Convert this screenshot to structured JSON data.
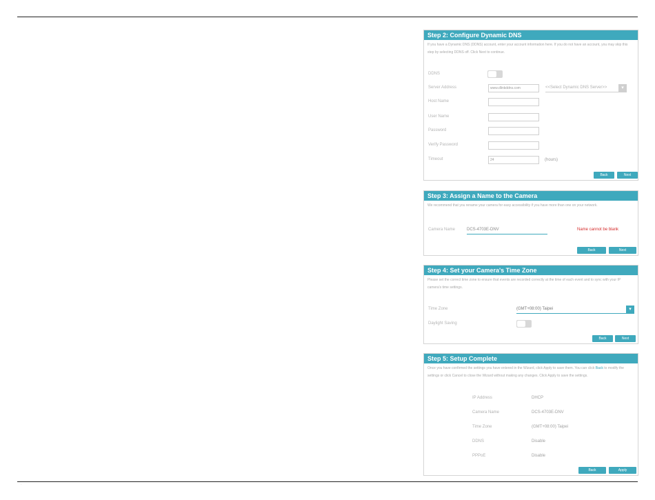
{
  "page": {
    "page_mark": "·"
  },
  "step2": {
    "title": "Step 2: Configure Dynamic DNS",
    "description": "If you have a Dynamic DNS (DDNS) account, enter your account information here. If you do not have an account, you may skip this step by selecting DDNS off. Click Next to continue.",
    "ddns_label": "DDNS",
    "server_address_label": "Server Address",
    "server_address_value": "www.dlinkddns.com",
    "server_select_value": "<<Select Dynamic DNS Server>>",
    "host_name_label": "Host Name",
    "user_name_label": "User Name",
    "password_label": "Password",
    "verify_password_label": "Verify Password",
    "timeout_label": "Timeout",
    "timeout_value": "24",
    "timeout_unit": "(hours)",
    "back_label": "Back",
    "next_label": "Next"
  },
  "step3": {
    "title": "Step 3: Assign a Name to the Camera",
    "description": "We recommend that you rename your camera for easy accessibility if you have more than one on your network.",
    "camera_name_label": "Camera Name",
    "camera_name_value": "DCS-4703E-DNV",
    "warning": "Name cannot be blank",
    "back_label": "Back",
    "next_label": "Next"
  },
  "step4": {
    "title": "Step 4: Set your Camera's Time Zone",
    "description": "Please set the correct time zone to ensure that events are recorded correctly at the time of each event and to sync with your IP camera's time settings.",
    "time_zone_label": "Time Zone",
    "time_zone_value": "(GMT+08:00) Taipei",
    "daylight_saving_label": "Daylight Saving",
    "back_label": "Back",
    "next_label": "Next"
  },
  "step5": {
    "title": "Step 5: Setup Complete",
    "description_part1": "Once you have confirmed the settings you have entered in the Wizard, click Apply to save them. You can click",
    "description_link": "Back",
    "description_part2": "to modify the settings or click Cancel to close the Wizard without making any changes. Click Apply to save the settings.",
    "rows": [
      {
        "label": "IP Address",
        "value": "DHCP"
      },
      {
        "label": "Camera Name",
        "value": "DCS-4703E-DNV"
      },
      {
        "label": "Time Zone",
        "value": "(GMT+08:00) Taipei"
      },
      {
        "label": "DDNS",
        "value": "Disable"
      },
      {
        "label": "PPPoE",
        "value": "Disable"
      }
    ],
    "back_label": "Back",
    "apply_label": "Apply"
  },
  "colors": {
    "accent": "#3fa9bd",
    "warning": "#d42b2b",
    "rule": "#222222"
  }
}
